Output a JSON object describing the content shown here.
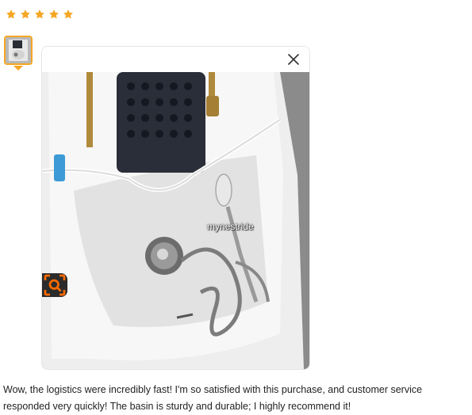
{
  "rating": {
    "stars": 5,
    "max": 5,
    "star_color": "#f5a623"
  },
  "thumbnail": {
    "selected": true,
    "accent_color": "#f5a623"
  },
  "viewer": {
    "close_icon": "close-icon",
    "watermark": "mynestride",
    "lens_icon": "image-search-icon",
    "lens_color": "#ff6a00"
  },
  "review": {
    "text": "Wow, the logistics were incredibly fast! I'm so satisfied with this purchase, and customer service responded very quickly! The basin is sturdy and durable; I highly recommend it!"
  }
}
